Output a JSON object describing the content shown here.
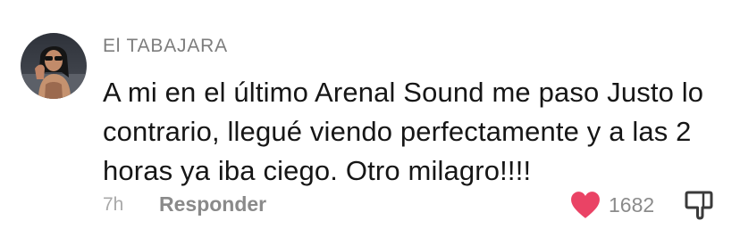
{
  "comment": {
    "username": "El TABAJARA",
    "text_lines": [
      "A mi en el último Arenal Sound me paso Justo lo",
      "contrario, llegué viendo perfectamente y a las 2",
      "horas ya iba ciego. Otro milagro!!!!"
    ],
    "timestamp": "7h",
    "reply_label": "Responder",
    "like_count": "1682",
    "liked": true
  },
  "colors": {
    "heart": "#ea4365",
    "username": "#7d7d7d",
    "text": "#161616",
    "meta": "#a9a9a9"
  },
  "icons": {
    "like": "heart-icon",
    "dislike": "thumbs-down-icon",
    "avatar": "user-avatar"
  }
}
